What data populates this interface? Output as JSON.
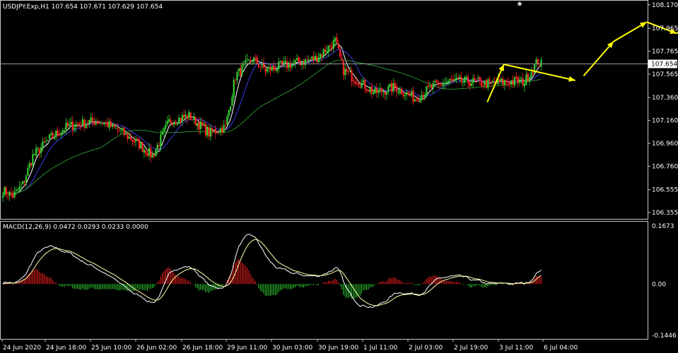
{
  "header": {
    "title": "USDJPY.Exp,H1  107.654 107.671 107.629 107.654",
    "corner_icon": "arrow-up-down-icon"
  },
  "macd": {
    "label": "MACD(12,26,9) 0.0472 0.0293 0.0233 0.0000"
  },
  "colors": {
    "background": "#000000",
    "bull": "#32cd32",
    "bear": "#ff2020",
    "ma_fast": "#ffffff",
    "ma_mid": "#3a3ae8",
    "ma_slow": "#2e8b2e",
    "bid_line": "#9a9a9a",
    "forecast": "#ffff00",
    "frame": "#c8c8c8",
    "price_tag_bg": "#ffffff",
    "price_tag_text": "#000000"
  },
  "chart_data": [
    {
      "type": "candlestick",
      "symbol": "USDJPY.Exp",
      "timeframe": "H1",
      "ylim": [
        106.3,
        108.2
      ],
      "y_ticks": [
        "108.170",
        "107.965",
        "107.765",
        "107.565",
        "107.360",
        "107.160",
        "106.960",
        "106.760",
        "106.555",
        "106.355"
      ],
      "current_price": "107.654",
      "x_ticks": [
        "24 Jun 2020",
        "24 Jun 18:00",
        "25 Jun 10:00",
        "26 Jun 02:00",
        "26 Jun 18:00",
        "29 Jun 11:00",
        "30 Jun 03:00",
        "30 Jun 19:00",
        "1 Jul 11:00",
        "2 Jul 03:00",
        "2 Jul 19:00",
        "3 Jul 11:00",
        "6 Jul 04:00"
      ],
      "close_anchors": [
        [
          0,
          106.55
        ],
        [
          6,
          106.5
        ],
        [
          12,
          106.6
        ],
        [
          18,
          106.85
        ],
        [
          28,
          107.0
        ],
        [
          38,
          107.1
        ],
        [
          52,
          107.15
        ],
        [
          60,
          107.15
        ],
        [
          72,
          107.05
        ],
        [
          82,
          106.95
        ],
        [
          90,
          106.85
        ],
        [
          100,
          107.15
        ],
        [
          112,
          107.2
        ],
        [
          124,
          107.05
        ],
        [
          134,
          107.1
        ],
        [
          140,
          107.55
        ],
        [
          150,
          107.7
        ],
        [
          158,
          107.6
        ],
        [
          172,
          107.65
        ],
        [
          188,
          107.7
        ],
        [
          200,
          107.85
        ],
        [
          205,
          107.6
        ],
        [
          214,
          107.5
        ],
        [
          224,
          107.4
        ],
        [
          236,
          107.45
        ],
        [
          248,
          107.35
        ],
        [
          258,
          107.45
        ],
        [
          268,
          107.5
        ],
        [
          280,
          107.5
        ],
        [
          292,
          107.48
        ],
        [
          304,
          107.5
        ],
        [
          314,
          107.5
        ],
        [
          322,
          107.68
        ],
        [
          324,
          107.65
        ]
      ],
      "moving_averages": [
        {
          "period": "fast",
          "color": "#ffffff"
        },
        {
          "period": "mid",
          "color": "#3a3ae8"
        },
        {
          "period": "slow",
          "color": "#2e8b2e"
        }
      ],
      "forecast_path": [
        [
          292,
          107.32
        ],
        [
          302,
          107.65
        ],
        [
          345,
          107.51
        ],
        [
          350,
          107.55
        ],
        [
          368,
          107.85
        ],
        [
          388,
          108.02
        ],
        [
          406,
          107.92
        ],
        [
          424,
          108.16
        ]
      ]
    },
    {
      "type": "macd",
      "params": "12,26,9",
      "ylim": [
        -0.1446,
        0.1673
      ],
      "y_ticks": [
        "0.1673",
        "0.00",
        "-0.1446"
      ],
      "values": {
        "macd": 0.0472,
        "signal": 0.0293,
        "histogram": 0.0233,
        "extra": 0.0
      }
    }
  ]
}
